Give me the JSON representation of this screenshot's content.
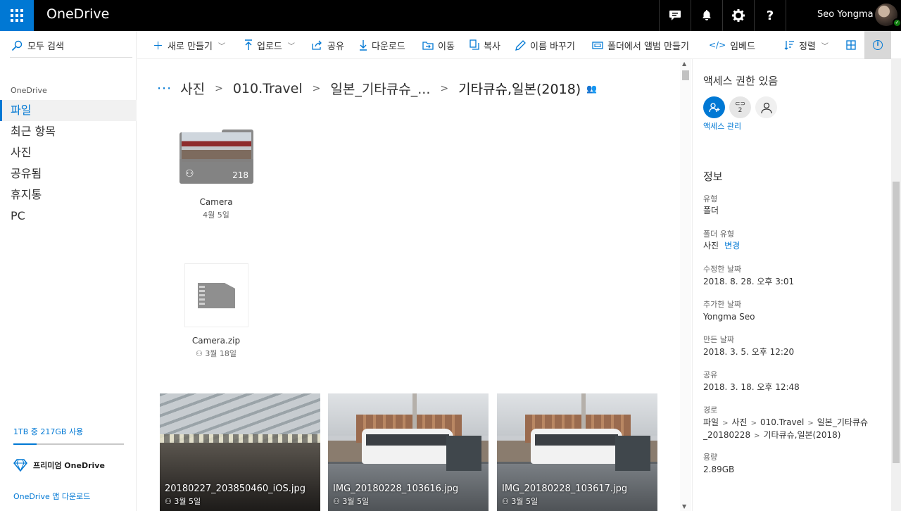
{
  "app": {
    "brand": "OneDrive"
  },
  "header": {
    "icons": [
      "chat-icon",
      "bell-icon",
      "gear-icon",
      "help-icon"
    ],
    "user_name": "Seo Yongma"
  },
  "sidebar": {
    "search_label": "모두 검색",
    "section_label": "OneDrive",
    "items": [
      {
        "label": "파일",
        "active": true
      },
      {
        "label": "최근 항목",
        "active": false
      },
      {
        "label": "사진",
        "active": false
      },
      {
        "label": "공유됨",
        "active": false
      },
      {
        "label": "휴지통",
        "active": false
      },
      {
        "label": "PC",
        "active": false
      }
    ],
    "storage_text": "1TB 중 217GB 사용",
    "storage_used_fraction": 0.21,
    "premium_label": "프리미엄 OneDrive",
    "app_download": "OneDrive 앱 다운로드"
  },
  "commands": {
    "new": "새로 만들기",
    "upload": "업로드",
    "share": "공유",
    "download": "다운로드",
    "move": "이동",
    "copy": "복사",
    "rename": "이름 바꾸기",
    "album": "폴더에서 앨범 만들기",
    "embed": "임베드",
    "sort": "정렬"
  },
  "breadcrumb": {
    "items": [
      "사진",
      "010.Travel",
      "일본_기타큐슈_...",
      "기타큐슈,일본(2018)"
    ]
  },
  "files": {
    "folder": {
      "name": "Camera",
      "date": "4월 5일",
      "count": "218"
    },
    "zip": {
      "name": "Camera.zip",
      "date": "3월 18일"
    },
    "photos": [
      {
        "name": "20180227_203850460_iOS.jpg",
        "date": "3월 5일"
      },
      {
        "name": "IMG_20180228_103616.jpg",
        "date": "3월 5일"
      },
      {
        "name": "IMG_20180228_103617.jpg",
        "date": "3월 5일"
      }
    ]
  },
  "details": {
    "access_title": "액세스 권한 있음",
    "access_shared_count": "2",
    "manage_access": "액세스 관리",
    "info_title": "정보",
    "type_label": "유형",
    "type_value": "폴더",
    "folder_type_label": "폴더 유형",
    "folder_type_value": "사진",
    "folder_type_change": "변경",
    "modified_label": "수정한 날짜",
    "modified_value": "2018. 8. 28. 오후 3:01",
    "added_label": "추가한 날짜",
    "added_value": "Yongma Seo",
    "created_label": "만든 날짜",
    "created_value": "2018. 3. 5. 오후 12:20",
    "shared_label": "공유",
    "shared_value": "2018. 3. 18. 오후 12:48",
    "path_label": "경로",
    "path": [
      "파일",
      "사진",
      "010.Travel",
      "일본_기타큐슈_20180228",
      "기타큐슈,일본(2018)"
    ],
    "size_label": "용량",
    "size_value": "2.89GB"
  },
  "colors": {
    "accent": "#0078d4",
    "topbar": "#000000",
    "active_bg": "#f1f1f1"
  }
}
